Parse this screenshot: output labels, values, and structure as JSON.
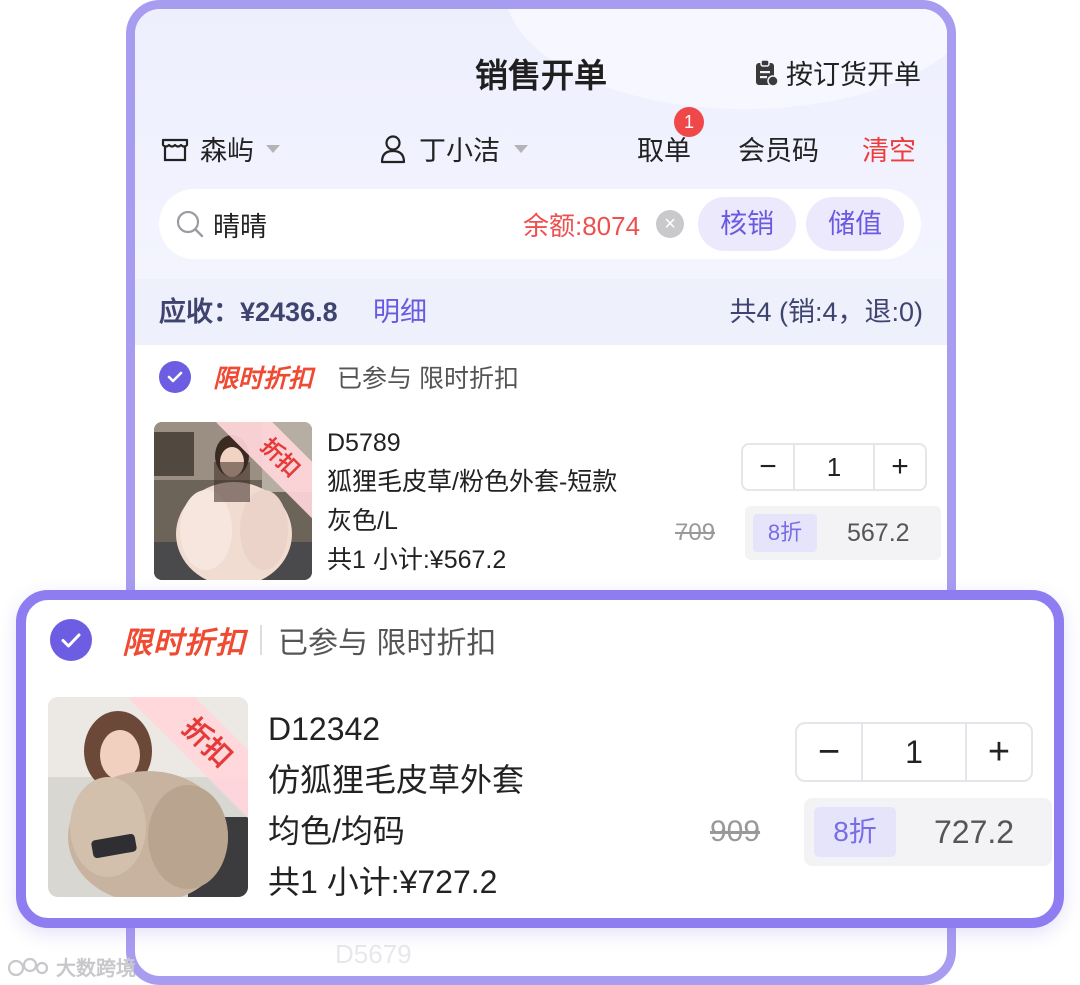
{
  "header": {
    "title": "销售开单",
    "order_link_label": "按订货开单",
    "order_link_icon": "clipboard-icon"
  },
  "filters": {
    "store_label": "森屿",
    "store_icon": "store-icon",
    "staff_label": "丁小洁",
    "staff_icon": "user-icon",
    "take_order_label": "取单",
    "take_order_badge": "1",
    "member_code_label": "会员码",
    "clear_label": "清空"
  },
  "search": {
    "value": "晴晴",
    "balance_text": "余额:8074",
    "verify_label": "核销",
    "recharge_label": "储值"
  },
  "summary": {
    "due_text": "应收：¥2436.8",
    "detail_label": "明细",
    "counts_text": "共4 (销:4，退:0)"
  },
  "items": [
    {
      "promo_tag": "限时折扣",
      "promo_joined": "已参与 限时折扣",
      "ribbon": "折扣",
      "sku": "D5789",
      "name": "狐狸毛皮草/粉色外套-短款",
      "variant": "灰色/L",
      "subtotal": "共1 小计:¥567.2",
      "qty": "1",
      "original_price": "709",
      "discount": "8折",
      "final_price": "567.2"
    },
    {
      "promo_tag": "限时折扣",
      "promo_joined": "已参与 限时折扣",
      "ribbon": "折扣",
      "sku": "D12342",
      "name": "仿狐狸毛皮草外套",
      "variant": "均色/均码",
      "subtotal": "共1 小计:¥727.2",
      "qty": "1",
      "original_price": "909",
      "discount": "8折",
      "final_price": "727.2"
    }
  ],
  "next_item_sku": "D5679",
  "watermark": "大数跨境",
  "colors": {
    "accent": "#6d5de2",
    "frame": "#a89cf0",
    "danger": "#ef4a32"
  }
}
